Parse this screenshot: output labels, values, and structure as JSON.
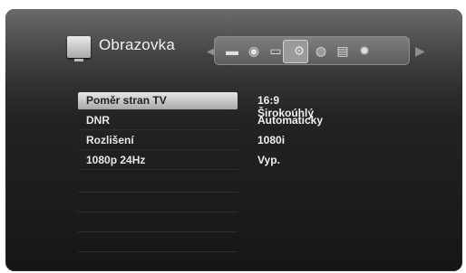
{
  "header": {
    "title": "Obrazovka",
    "category_icons": [
      "movie-icon",
      "audio-icon",
      "display-icon",
      "settings-icon",
      "web-icon",
      "folder-icon",
      "gear-icon"
    ],
    "selected_icon_index": 2
  },
  "settings": {
    "rows": [
      {
        "label": "Poměr stran TV",
        "value": "16:9 Širokoúhlý"
      },
      {
        "label": "DNR",
        "value": "Automaticky"
      },
      {
        "label": "Rozlišení",
        "value": "1080i"
      },
      {
        "label": "1080p 24Hz",
        "value": "Vyp."
      }
    ],
    "selected_index": 0
  },
  "colors": {
    "panel": "#2a2a2a",
    "selection": "#cfcfcf",
    "text": "#f0f0f0"
  }
}
